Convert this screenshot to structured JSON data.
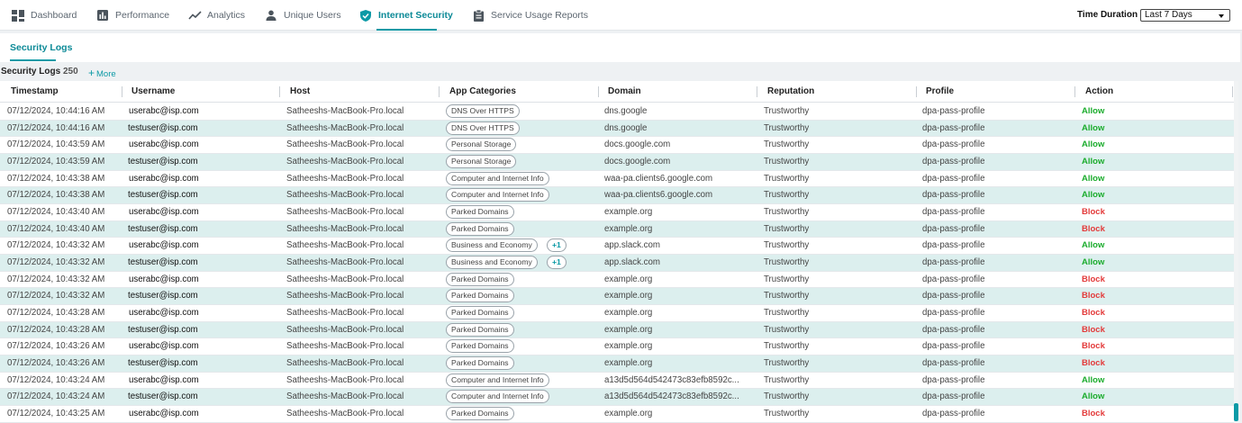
{
  "nav": {
    "tabs": [
      {
        "label": "Dashboard",
        "icon": "dashboard-icon"
      },
      {
        "label": "Performance",
        "icon": "bar-chart-icon"
      },
      {
        "label": "Analytics",
        "icon": "trend-line-icon"
      },
      {
        "label": "Unique Users",
        "icon": "user-icon"
      },
      {
        "label": "Internet Security",
        "icon": "shield-check-icon"
      },
      {
        "label": "Service Usage Reports",
        "icon": "clipboard-icon"
      }
    ],
    "active_tab": "Internet Security",
    "time_duration_label": "Time Duration",
    "time_duration_value": "Last 7 Days"
  },
  "subnav": {
    "tab": "Security Logs"
  },
  "logs": {
    "title": "Security Logs",
    "count": "250",
    "more_label": "More"
  },
  "table": {
    "columns": [
      "Timestamp",
      "Username",
      "Host",
      "App Categories",
      "Domain",
      "Reputation",
      "Profile",
      "Action"
    ],
    "rows": [
      {
        "timestamp": "07/12/2024, 10:44:16 AM",
        "username": "userabc@isp.com",
        "host": "Satheeshs-MacBook-Pro.local",
        "category": "DNS Over HTTPS",
        "extra": "",
        "domain": "dns.google",
        "reputation": "Trustworthy",
        "profile": "dpa-pass-profile",
        "action": "Allow"
      },
      {
        "timestamp": "07/12/2024, 10:44:16 AM",
        "username": "testuser@isp.com",
        "host": "Satheeshs-MacBook-Pro.local",
        "category": "DNS Over HTTPS",
        "extra": "",
        "domain": "dns.google",
        "reputation": "Trustworthy",
        "profile": "dpa-pass-profile",
        "action": "Allow"
      },
      {
        "timestamp": "07/12/2024, 10:43:59 AM",
        "username": "userabc@isp.com",
        "host": "Satheeshs-MacBook-Pro.local",
        "category": "Personal Storage",
        "extra": "",
        "domain": "docs.google.com",
        "reputation": "Trustworthy",
        "profile": "dpa-pass-profile",
        "action": "Allow"
      },
      {
        "timestamp": "07/12/2024, 10:43:59 AM",
        "username": "testuser@isp.com",
        "host": "Satheeshs-MacBook-Pro.local",
        "category": "Personal Storage",
        "extra": "",
        "domain": "docs.google.com",
        "reputation": "Trustworthy",
        "profile": "dpa-pass-profile",
        "action": "Allow"
      },
      {
        "timestamp": "07/12/2024, 10:43:38 AM",
        "username": "userabc@isp.com",
        "host": "Satheeshs-MacBook-Pro.local",
        "category": "Computer and Internet Info",
        "extra": "",
        "domain": "waa-pa.clients6.google.com",
        "reputation": "Trustworthy",
        "profile": "dpa-pass-profile",
        "action": "Allow"
      },
      {
        "timestamp": "07/12/2024, 10:43:38 AM",
        "username": "testuser@isp.com",
        "host": "Satheeshs-MacBook-Pro.local",
        "category": "Computer and Internet Info",
        "extra": "",
        "domain": "waa-pa.clients6.google.com",
        "reputation": "Trustworthy",
        "profile": "dpa-pass-profile",
        "action": "Allow"
      },
      {
        "timestamp": "07/12/2024, 10:43:40 AM",
        "username": "userabc@isp.com",
        "host": "Satheeshs-MacBook-Pro.local",
        "category": "Parked Domains",
        "extra": "",
        "domain": "example.org",
        "reputation": "Trustworthy",
        "profile": "dpa-pass-profile",
        "action": "Block"
      },
      {
        "timestamp": "07/12/2024, 10:43:40 AM",
        "username": "testuser@isp.com",
        "host": "Satheeshs-MacBook-Pro.local",
        "category": "Parked Domains",
        "extra": "",
        "domain": "example.org",
        "reputation": "Trustworthy",
        "profile": "dpa-pass-profile",
        "action": "Block"
      },
      {
        "timestamp": "07/12/2024, 10:43:32 AM",
        "username": "userabc@isp.com",
        "host": "Satheeshs-MacBook-Pro.local",
        "category": "Business and Economy",
        "extra": "+1",
        "domain": "app.slack.com",
        "reputation": "Trustworthy",
        "profile": "dpa-pass-profile",
        "action": "Allow"
      },
      {
        "timestamp": "07/12/2024, 10:43:32 AM",
        "username": "testuser@isp.com",
        "host": "Satheeshs-MacBook-Pro.local",
        "category": "Business and Economy",
        "extra": "+1",
        "domain": "app.slack.com",
        "reputation": "Trustworthy",
        "profile": "dpa-pass-profile",
        "action": "Allow"
      },
      {
        "timestamp": "07/12/2024, 10:43:32 AM",
        "username": "userabc@isp.com",
        "host": "Satheeshs-MacBook-Pro.local",
        "category": "Parked Domains",
        "extra": "",
        "domain": "example.org",
        "reputation": "Trustworthy",
        "profile": "dpa-pass-profile",
        "action": "Block"
      },
      {
        "timestamp": "07/12/2024, 10:43:32 AM",
        "username": "testuser@isp.com",
        "host": "Satheeshs-MacBook-Pro.local",
        "category": "Parked Domains",
        "extra": "",
        "domain": "example.org",
        "reputation": "Trustworthy",
        "profile": "dpa-pass-profile",
        "action": "Block"
      },
      {
        "timestamp": "07/12/2024, 10:43:28 AM",
        "username": "userabc@isp.com",
        "host": "Satheeshs-MacBook-Pro.local",
        "category": "Parked Domains",
        "extra": "",
        "domain": "example.org",
        "reputation": "Trustworthy",
        "profile": "dpa-pass-profile",
        "action": "Block"
      },
      {
        "timestamp": "07/12/2024, 10:43:28 AM",
        "username": "testuser@isp.com",
        "host": "Satheeshs-MacBook-Pro.local",
        "category": "Parked Domains",
        "extra": "",
        "domain": "example.org",
        "reputation": "Trustworthy",
        "profile": "dpa-pass-profile",
        "action": "Block"
      },
      {
        "timestamp": "07/12/2024, 10:43:26 AM",
        "username": "userabc@isp.com",
        "host": "Satheeshs-MacBook-Pro.local",
        "category": "Parked Domains",
        "extra": "",
        "domain": "example.org",
        "reputation": "Trustworthy",
        "profile": "dpa-pass-profile",
        "action": "Block"
      },
      {
        "timestamp": "07/12/2024, 10:43:26 AM",
        "username": "testuser@isp.com",
        "host": "Satheeshs-MacBook-Pro.local",
        "category": "Parked Domains",
        "extra": "",
        "domain": "example.org",
        "reputation": "Trustworthy",
        "profile": "dpa-pass-profile",
        "action": "Block"
      },
      {
        "timestamp": "07/12/2024, 10:43:24 AM",
        "username": "userabc@isp.com",
        "host": "Satheeshs-MacBook-Pro.local",
        "category": "Computer and Internet Info",
        "extra": "",
        "domain": "a13d5d564d542473c83efb8592c...",
        "reputation": "Trustworthy",
        "profile": "dpa-pass-profile",
        "action": "Allow"
      },
      {
        "timestamp": "07/12/2024, 10:43:24 AM",
        "username": "testuser@isp.com",
        "host": "Satheeshs-MacBook-Pro.local",
        "category": "Computer and Internet Info",
        "extra": "",
        "domain": "a13d5d564d542473c83efb8592c...",
        "reputation": "Trustworthy",
        "profile": "dpa-pass-profile",
        "action": "Allow"
      },
      {
        "timestamp": "07/12/2024, 10:43:25 AM",
        "username": "userabc@isp.com",
        "host": "Satheeshs-MacBook-Pro.local",
        "category": "Parked Domains",
        "extra": "",
        "domain": "example.org",
        "reputation": "Trustworthy",
        "profile": "dpa-pass-profile",
        "action": "Block"
      }
    ]
  },
  "colors": {
    "accent": "#0c9aa6",
    "row_alt": "#dcefee",
    "allow": "#1aac2c",
    "block": "#e33a3a"
  }
}
